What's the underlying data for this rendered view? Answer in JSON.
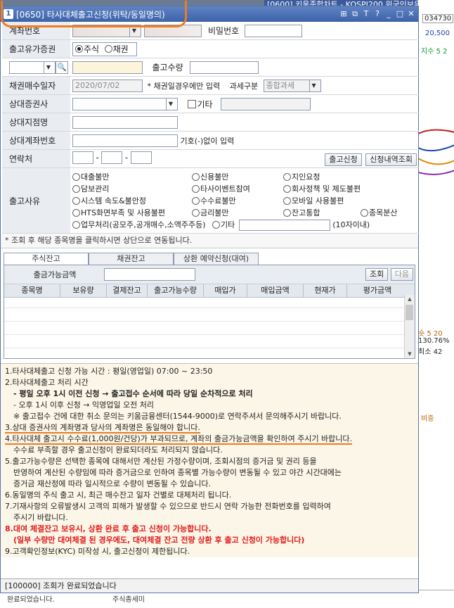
{
  "background": {
    "top_title": "[0600] 키움종합차트 - KOSPI200 위국인보유",
    "right_values": [
      "034730",
      "20,500",
      "지수 5  2",
      "숏 5  20",
      "130.76%",
      "최소 42",
      "비중"
    ],
    "bottom_texts": [
      "완료되었습니다.",
      "주식종세미"
    ]
  },
  "window": {
    "number": "1",
    "title": "[0650] 타사대체출고신청(위탁/동일명의)",
    "controls": [
      "⊞",
      "⧉",
      "T",
      "?",
      "_",
      "□",
      "✕"
    ]
  },
  "form": {
    "account_label": "계좌번호",
    "password_label": "비밀번호",
    "securities_type_label": "출고유가증권",
    "radio_stock": "주식",
    "radio_bond": "채권",
    "quantity_label": "출고수량",
    "bond_date_label": "채권매수일자",
    "bond_date_value": "2020/07/02",
    "bond_date_note": "* 채권일경우에만 입력",
    "tax_label": "과세구분",
    "tax_value": "종합과세",
    "counter_broker_label": "상대증권사",
    "other_label": "기타",
    "counter_branch_label": "상대지점명",
    "counter_account_label": "상대계좌번호",
    "counter_account_note": "기호(-)없이 입력",
    "contact_label": "연락처",
    "contact_sep": "-",
    "request_button": "출고신청",
    "history_button": "신청내역조회",
    "reason_label": "출고사유",
    "reasons": [
      "대출불만",
      "신용불만",
      "지인요청",
      "담보관리",
      "타사이벤트참여",
      "회사정책 및 제도불편",
      "시스템 속도&불안정",
      "수수료불만",
      "모바일 사용불편",
      "HTS화면부족 및 사용불편",
      "금리불만",
      "잔고통합",
      "종목분산",
      "업무처리(공모주,공개매수,소액주주등)",
      "기타"
    ],
    "reason_limit": "(10자이내)"
  },
  "note": "* 조회 후 해당 종목명을 클릭하시면 상단으로 연동됩니다.",
  "tabs": [
    "주식잔고",
    "채권잔고",
    "상환 예약신청(대여)"
  ],
  "balance": {
    "available_label": "출금가능금액",
    "search_button": "조회",
    "next_button": "다음",
    "columns": [
      "종목명",
      "보유량",
      "결제잔고",
      "출고가능수량",
      "매입가",
      "매입금액",
      "현재가",
      "평가금액"
    ]
  },
  "info_lines": [
    "1.타사대체출고 신청 가능 시간 : 평일(영업일) 07:00 ~ 23:50",
    "2.타사대체출고 처리 시간",
    "- 평일 오후 1시 이전 신청 → 출고접수 순서에 따라 당일 순차적으로 처리",
    "- 오후 1시 이후 신청 → 익영업일 오전 처리",
    "※ 출고접수 건에 대한 취소 문의는 키움금융센터(1544-9000)로 연락주셔서 문의해주시기 바랍니다.",
    "3.상대 증권사의 계좌명과 당사의 계좌명은 동일해야 합니다.",
    "4.타사대체 출고시 수수료(1,000원/건당)가 부과되므로, 계좌의 출금가능금액을 확인하여 주시기 바랍니다.",
    "수수료 부족할 경우 출고신청이 완료되더라도 처리되지 않습니다.",
    "5.출고가능수량은 선택한 종목에 대해서만 계산된 가정수량이며, 조회시점의 증거금 및 권리 등을",
    "반영하여 계산된 수량임에 따라 증거금으로 인하여 종목별 가능수량이 변동될 수 있고 야간 시간대에는",
    "증거금 재산정에 따라 일시적으로 수량이 변동될 수 있습니다.",
    "6.동일명의 주식 출고 시, 최근 매수잔고 일자 건별로 대체처리 됩니다.",
    "7.기재사항의 오류발생시 고객의 피해가 발생할 수 있으므로 반드시 연락 가능한 전화번호를 입력하여",
    "주시기 바랍니다.",
    "8.대여 체결잔고 보유시, 상환 완료 후 출고 신청이 가능합니다.",
    "(일부 수량만 대여체결 된 경우에도, 대여체결 잔고 전량 상환 후 출고 신청이 가능합니다)",
    "9.고객확인정보(KYC) 미작성 시, 출고신청이 제한됩니다."
  ],
  "status": "[100000] 조회가 완료되었습니다",
  "colors": {
    "accent": "#f07b20",
    "title_bar": "#3c62a8",
    "red_text": "#e21b1b",
    "info_bg": "#fbf6e7"
  }
}
